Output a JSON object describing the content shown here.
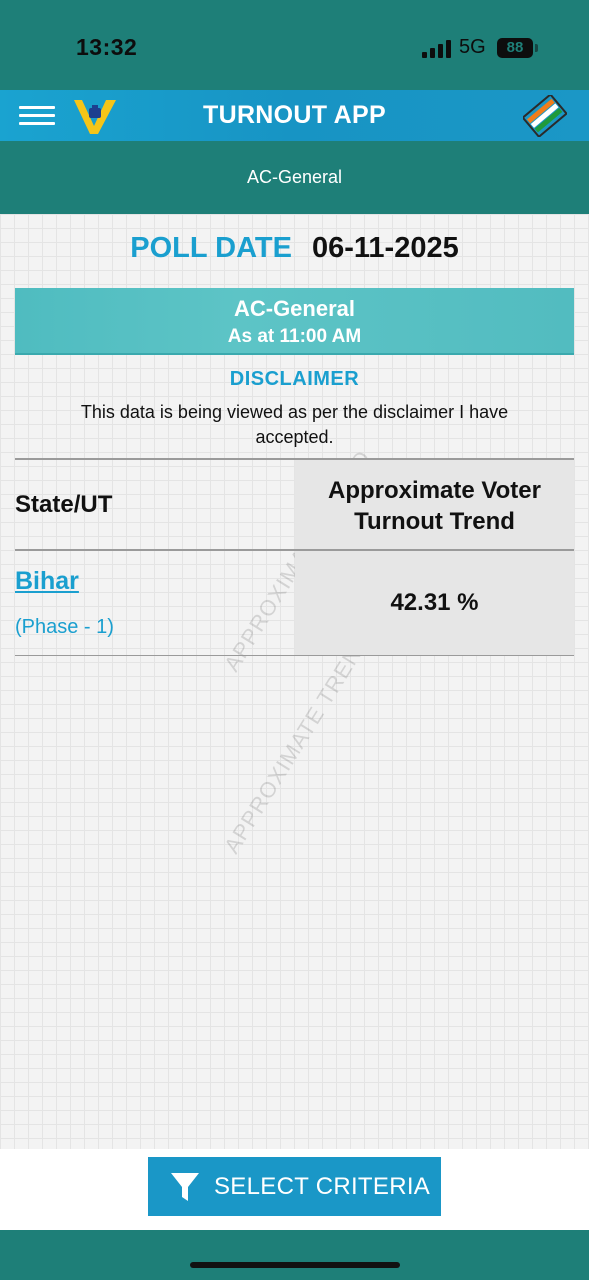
{
  "status_bar": {
    "time": "13:32",
    "network": "5G",
    "battery": "88"
  },
  "app_bar": {
    "title": "TURNOUT APP",
    "menu_icon": "hamburger-menu-icon",
    "logo_icon": "voter-app-logo",
    "eci_icon": "election-commission-logo"
  },
  "sub_header": {
    "title": "AC-General"
  },
  "poll": {
    "label": "POLL DATE",
    "date": "06-11-2025"
  },
  "banner": {
    "title": "AC-General",
    "time": "As at 11:00 AM"
  },
  "disclaimer": {
    "title": "DISCLAIMER",
    "text": "This data is being viewed as per the disclaimer I have accepted."
  },
  "table": {
    "headers": [
      "State/UT",
      "Approximate Voter Turnout Trend"
    ],
    "rows": [
      {
        "state": "Bihar",
        "phase": "(Phase - 1)",
        "turnout": "42.31 %"
      }
    ]
  },
  "watermark": "APPROXIMATE TREND",
  "actions": {
    "select_criteria": "SELECT CRITERIA",
    "select_icon": "filter-icon"
  },
  "colors": {
    "teal": "#1e7f78",
    "blue": "#1a9fcf",
    "banner": "#5dc4c6"
  }
}
